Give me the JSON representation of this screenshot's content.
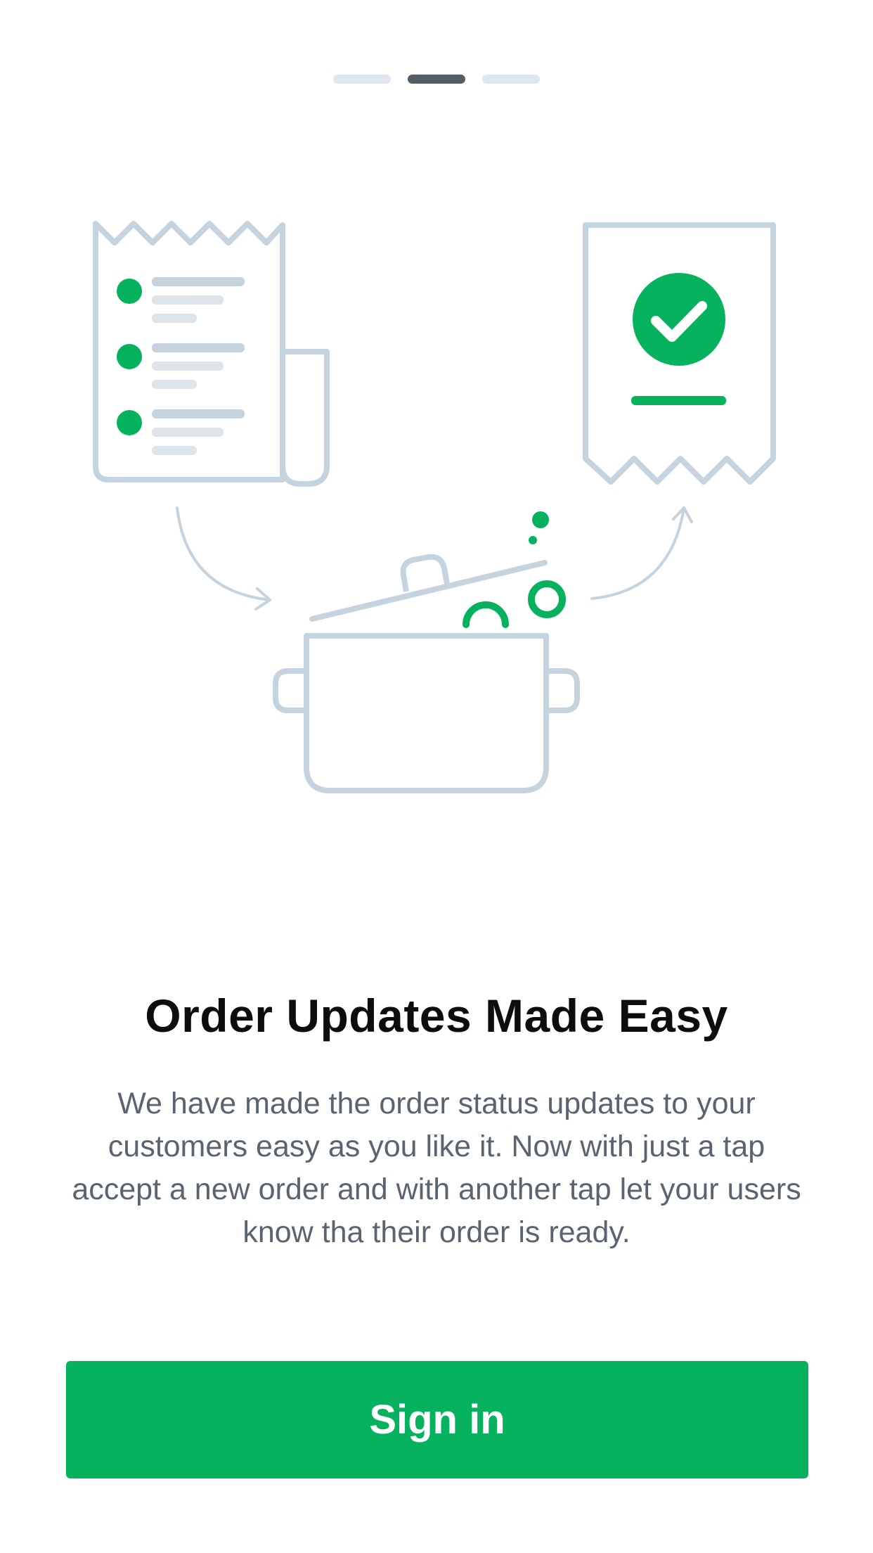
{
  "pager": {
    "total": 3,
    "active_index": 1
  },
  "illustration": {
    "icons": [
      "order-receipt-icon",
      "cooking-pot-icon",
      "completed-receipt-icon",
      "checkmark-icon"
    ],
    "colors": {
      "outline": "#c5d3df",
      "accent": "#06b25e",
      "line_light": "#dde4ea"
    }
  },
  "onboarding": {
    "title": "Order Updates Made Easy",
    "description": "We have made the order status updates to your customers easy as you like it. Now with just a tap accept a new order and with another tap let your users know tha their order is ready."
  },
  "actions": {
    "signin_label": "Sign in"
  },
  "colors": {
    "primary": "#06b25e",
    "title": "#0d0d0d",
    "body": "#5a6470",
    "pager_active": "#545c64",
    "pager_inactive": "#dfe6ee"
  }
}
